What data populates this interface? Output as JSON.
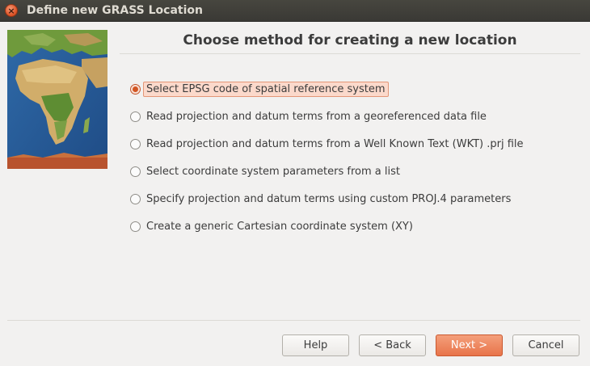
{
  "window": {
    "title": "Define new GRASS Location",
    "close_glyph": "×"
  },
  "page": {
    "heading": "Choose method for creating a new location"
  },
  "options": [
    {
      "label": "Select EPSG code of spatial reference system",
      "selected": true
    },
    {
      "label": "Read projection and datum terms from a georeferenced data file",
      "selected": false
    },
    {
      "label": "Read projection and datum terms from a Well Known Text (WKT) .prj file",
      "selected": false
    },
    {
      "label": "Select coordinate system parameters from a list",
      "selected": false
    },
    {
      "label": "Specify projection and datum terms using custom PROJ.4 parameters",
      "selected": false
    },
    {
      "label": "Create a generic Cartesian coordinate system (XY)",
      "selected": false
    }
  ],
  "buttons": {
    "help": "Help",
    "back": "< Back",
    "next": "Next >",
    "cancel": "Cancel"
  },
  "colors": {
    "accent": "#e8744a",
    "selection": "#fbd9cb"
  },
  "icons": {
    "close": "close-icon",
    "map": "world-map-image"
  }
}
